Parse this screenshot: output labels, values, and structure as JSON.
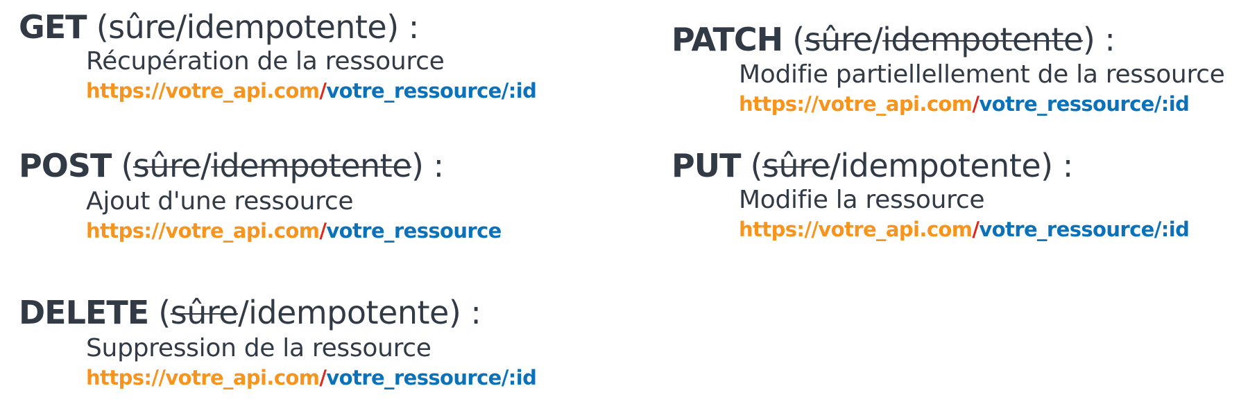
{
  "methods": {
    "get": {
      "verb": "GET",
      "paren_open": "(",
      "safe": "sûre",
      "sep": "/",
      "idempotent": "idempotente",
      "paren_close": ") :",
      "safe_struck": false,
      "idempotent_struck": false,
      "description": "Récupération de la ressource",
      "url_base": "https://votre_api.com",
      "url_slash": "/",
      "url_path": "votre_ressource/:id"
    },
    "post": {
      "verb": "POST",
      "paren_open": "(",
      "safe": "sûre",
      "sep": "/",
      "idempotent": "idempotente",
      "paren_close": ") :",
      "safe_struck": true,
      "idempotent_struck": true,
      "description": "Ajout d'une ressource",
      "url_base": "https://votre_api.com",
      "url_slash": "/",
      "url_path": "votre_ressource"
    },
    "delete": {
      "verb": "DELETE",
      "paren_open": "(",
      "safe": "sûre",
      "sep": "/",
      "idempotent": "idempotente",
      "paren_close": ") :",
      "safe_struck": true,
      "idempotent_struck": false,
      "description": "Suppression de la ressource",
      "url_base": "https://votre_api.com",
      "url_slash": "/",
      "url_path": "votre_ressource/:id"
    },
    "patch": {
      "verb": "PATCH",
      "paren_open": "(",
      "safe": "sûre",
      "sep": "/",
      "idempotent": "idempotente",
      "paren_close": ") :",
      "safe_struck": true,
      "idempotent_struck": true,
      "description": "Modifie partiellellement de la ressource",
      "url_base": "https://votre_api.com",
      "url_slash": "/",
      "url_path": "votre_ressource/:id"
    },
    "put": {
      "verb": "PUT",
      "paren_open": "(",
      "safe": "sûre",
      "sep": "/",
      "idempotent": "idempotente",
      "paren_close": ") :",
      "safe_struck": true,
      "idempotent_struck": false,
      "description": "Modifie la ressource",
      "url_base": "https://votre_api.com",
      "url_slash": "/",
      "url_path": "votre_ressource/:id"
    }
  },
  "colors": {
    "text": "#323a46",
    "url_base": "#f7941d",
    "url_slash": "#e1251b",
    "url_path": "#0b72b9"
  }
}
